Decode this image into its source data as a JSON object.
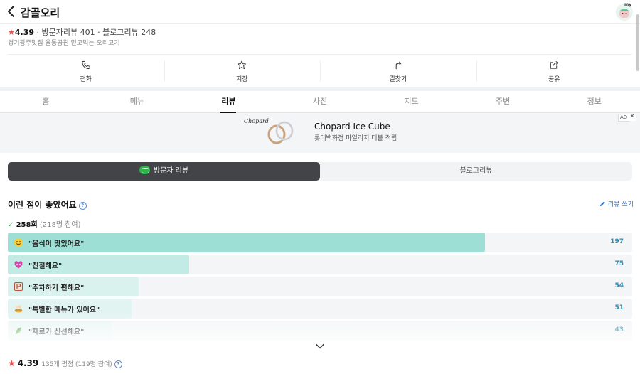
{
  "header": {
    "title": "감골오리",
    "avatar_tag": "my"
  },
  "place": {
    "rating": "4.39",
    "visitor_reviews": "방문자리뷰 401",
    "blog_reviews": "블로그리뷰 248",
    "description": "경기광주맛집 율동공원 믿고먹는 오리고기"
  },
  "actions": [
    {
      "label": "전화",
      "icon": "phone-icon"
    },
    {
      "label": "저장",
      "icon": "star-icon"
    },
    {
      "label": "길찾기",
      "icon": "directions-icon"
    },
    {
      "label": "공유",
      "icon": "share-icon"
    }
  ],
  "tabs": [
    "홈",
    "메뉴",
    "리뷰",
    "사진",
    "지도",
    "주변",
    "정보"
  ],
  "active_tab": "리뷰",
  "ad": {
    "brand": "Chopard",
    "title": "Chopard Ice Cube",
    "subtitle": "롯데백화점 마일리지 더블 적립",
    "tag": "AD",
    "close": "✕"
  },
  "review_type": {
    "visitor": "방문자 리뷰",
    "blog": "블로그리뷰"
  },
  "liked": {
    "title": "이런 점이 좋았어요",
    "write": "리뷰 쓰기",
    "count": "258",
    "count_unit": "회",
    "participants": "(218명 참여)",
    "items": [
      {
        "label": "\"음식이 맛있어요\"",
        "count": 197,
        "icon": "smiley-icon",
        "fill": "#9ddfd4"
      },
      {
        "label": "\"친절해요\"",
        "count": 75,
        "icon": "heart-face-icon",
        "fill": "#c2ebe5"
      },
      {
        "label": "\"주차하기 편해요\"",
        "count": 54,
        "icon": "parking-icon",
        "fill": "#daf2ee"
      },
      {
        "label": "\"특별한 메뉴가 있어요\"",
        "count": 51,
        "icon": "chef-icon",
        "fill": "#e2f4f1"
      },
      {
        "label": "\"재료가 신선해요\"",
        "count": 43,
        "icon": "leaf-icon",
        "fill": "#e9f6f4"
      }
    ],
    "max": 197
  },
  "bottom": {
    "rating": "4.39",
    "meta": "135개 평점 (119명 참여)"
  },
  "colors": {
    "accent_green": "#2db34a",
    "star_red": "#e94b4b",
    "count_blue": "#2f8bb0",
    "link_blue": "#2b6fd6"
  }
}
